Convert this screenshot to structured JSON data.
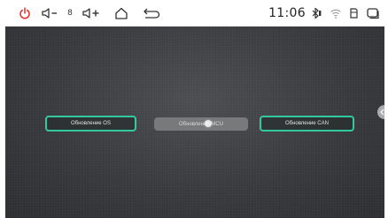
{
  "status_bar": {
    "icons": {
      "power": "power-icon",
      "volume_down": "volume-down-icon",
      "volume_up": "volume-up-icon",
      "home": "home-icon",
      "back": "back-icon",
      "bluetooth": "bluetooth-icon",
      "wifi": "wifi-icon",
      "sd_card": "sd-card-icon",
      "recent_apps": "recent-apps-icon"
    },
    "volume_level": "8",
    "time": "11:06",
    "accent_color": "#e53935"
  },
  "main": {
    "buttons": [
      {
        "label": "Обновление OS",
        "state": "active"
      },
      {
        "label": "Обновление MCU",
        "state": "inactive"
      },
      {
        "label": "Обновление CAN",
        "state": "active"
      }
    ],
    "active_border_color": "#33c9a0",
    "edge_handle_icon": "chevron-left-icon"
  }
}
